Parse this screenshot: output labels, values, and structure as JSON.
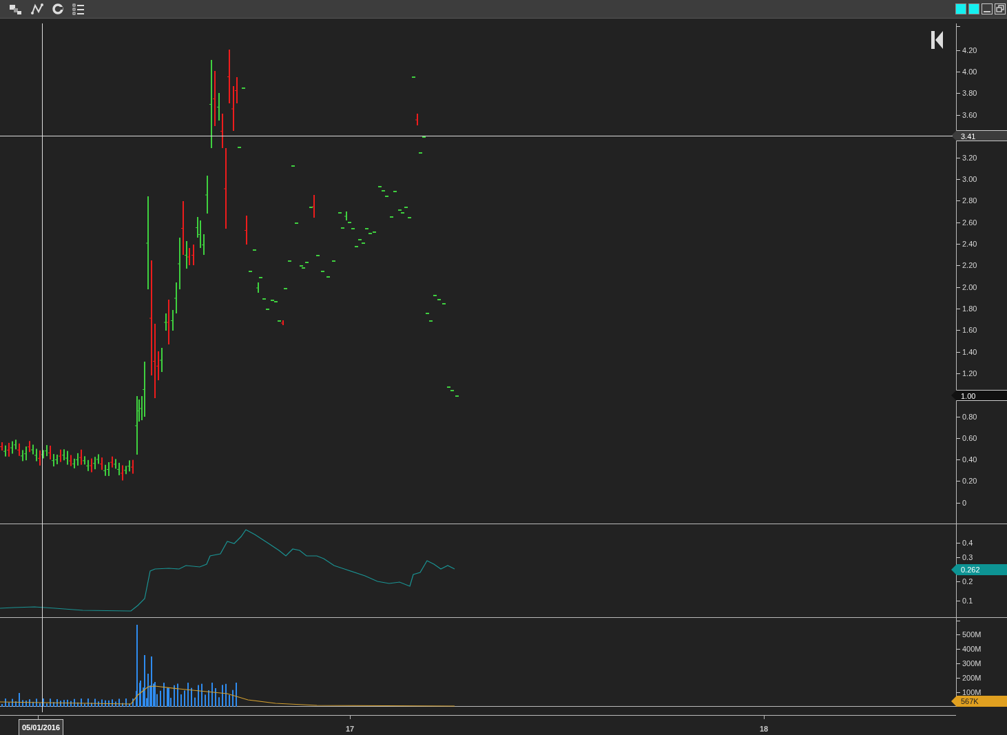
{
  "price_axis": {
    "ticks": [
      "4.20",
      "4.00",
      "3.80",
      "3.60",
      "3.20",
      "3.00",
      "2.80",
      "2.60",
      "2.40",
      "2.20",
      "2.00",
      "1.80",
      "1.60",
      "1.40",
      "1.20",
      "0.80",
      "0.60",
      "0.40",
      "0.20",
      "0"
    ],
    "last_price": "3.41",
    "marker": "1.00"
  },
  "indicator_axis": {
    "ticks": [
      "0.4",
      "0.3",
      "0.2",
      "0.1"
    ],
    "value": "0.262"
  },
  "volume_axis": {
    "ticks": [
      "500M",
      "400M",
      "300M",
      "200M",
      "100M"
    ],
    "value": "567K"
  },
  "time_axis": {
    "cursor_date": "05/01/2016",
    "labels": [
      "17",
      "18"
    ]
  }
}
